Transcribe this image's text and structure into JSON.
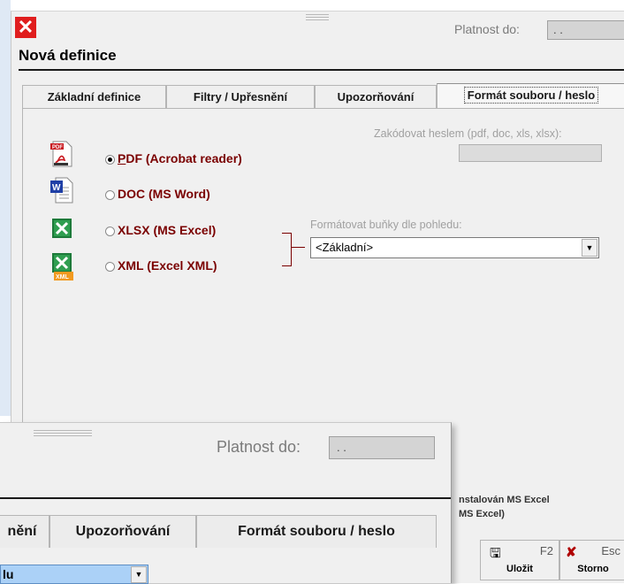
{
  "window": {
    "title": "Nová definice",
    "validity_label": "Platnost do:",
    "validity_value": ". ."
  },
  "tabs": [
    {
      "label": "Základní definice"
    },
    {
      "label": "Filtry / Upřesnění"
    },
    {
      "label": "Upozorňování"
    },
    {
      "label": "Formát souboru / heslo"
    }
  ],
  "formats": [
    {
      "label_prefix": "",
      "label_underlined": "P",
      "label_rest": "DF (Acrobat reader)",
      "icon": "pdf-icon",
      "checked": true
    },
    {
      "label_prefix": "",
      "label_underlined": "",
      "label_rest": "DOC (MS Word)",
      "icon": "word-doc-icon",
      "checked": false
    },
    {
      "label_prefix": "",
      "label_underlined": "",
      "label_rest": "XLSX (MS Excel)",
      "icon": "excel-xlsx-icon",
      "checked": false
    },
    {
      "label_prefix": "",
      "label_underlined": "",
      "label_rest": "XML (Excel XML)",
      "icon": "excel-xml-icon",
      "checked": false
    }
  ],
  "password": {
    "hint": "Zakódovat heslem (pdf, doc, xls, xlsx):",
    "value": ""
  },
  "cell_format": {
    "hint": "Formátovat buňky dle pohledu:",
    "value": "<Základní>"
  },
  "excel_note": {
    "line1": "nstalován MS Excel",
    "line2": "MS Excel)"
  },
  "actions": {
    "save": {
      "key": "F2",
      "label": "Uložit"
    },
    "cancel": {
      "key": "Esc",
      "label": "Storno"
    }
  },
  "window2": {
    "validity_label": "Platnost do:",
    "validity_value": ". .",
    "tabs": [
      {
        "label": "nění"
      },
      {
        "label": "Upozorňování"
      },
      {
        "label": "Formát souboru / heslo"
      }
    ],
    "select_value": "lu"
  },
  "colors": {
    "accent_dark_red": "#7a0000",
    "close_red": "#e01e1e",
    "selected_blue": "#abd1f7"
  }
}
